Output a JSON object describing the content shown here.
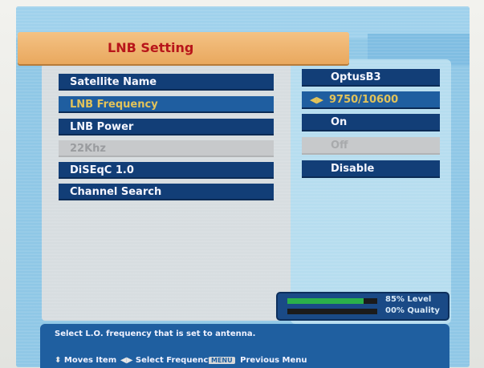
{
  "title": "LNB Setting",
  "menu": [
    {
      "label": "Satellite Name",
      "value": "OptusB3",
      "state": "normal"
    },
    {
      "label": "LNB Frequency",
      "value": "9750/10600",
      "state": "selected"
    },
    {
      "label": "LNB Power",
      "value": "On",
      "state": "normal"
    },
    {
      "label": "22Khz",
      "value": "Off",
      "state": "disabled"
    },
    {
      "label": "DiSEqC 1.0",
      "value": "Disable",
      "state": "normal"
    },
    {
      "label": "Channel Search",
      "value": "",
      "state": "normal"
    }
  ],
  "signal": {
    "level_text": "85% Level",
    "quality_text": "00% Quality",
    "level_fraction": 0.85,
    "quality_fraction": 0.0
  },
  "help": {
    "description": "Select L.O. frequency that is set to antenna.",
    "moves_label": "Moves Item",
    "select_label": "Select Frequency",
    "menu_key": "MENU",
    "previous_label": "Previous Menu"
  },
  "colors": {
    "item_bg": "#123e77",
    "selected_bg": "#1f5ea0",
    "selected_text": "#e2c35a",
    "title_bg": "#e9a85e",
    "title_text": "#b8151a",
    "level_bar": "#2bb04a"
  }
}
